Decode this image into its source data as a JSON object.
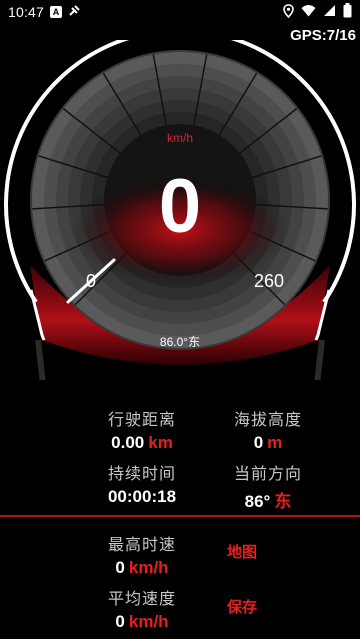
{
  "status_bar": {
    "time": "10:47",
    "icons": [
      "text-a-icon",
      "satellite-icon",
      "location-pin-icon",
      "wifi-icon",
      "cellular-signal-icon",
      "battery-icon"
    ]
  },
  "gps": {
    "label": "GPS:7/16"
  },
  "gauge": {
    "unit": "km/h",
    "speed": "0",
    "min_label": "0",
    "max_label": "260",
    "heading_text": "86.0°东",
    "speed_fraction": 0,
    "colors": {
      "accent": "#e2202a",
      "face": "#2c2c2c",
      "ring": "#ffffff"
    }
  },
  "stats": {
    "distance": {
      "label": "行驶距离",
      "value": "0.00",
      "unit": "km"
    },
    "altitude": {
      "label": "海拔高度",
      "value": "0",
      "unit": "m"
    },
    "duration": {
      "label": "持续时间",
      "value": "00:00:18",
      "unit": ""
    },
    "direction": {
      "label": "当前方向",
      "value": "86°",
      "unit": "东"
    },
    "max_speed": {
      "label": "最高时速",
      "value": "0",
      "unit": "km/h"
    },
    "avg_speed": {
      "label": "平均速度",
      "value": "0",
      "unit": "km/h"
    }
  },
  "actions": {
    "map": "地图",
    "save": "保存"
  }
}
